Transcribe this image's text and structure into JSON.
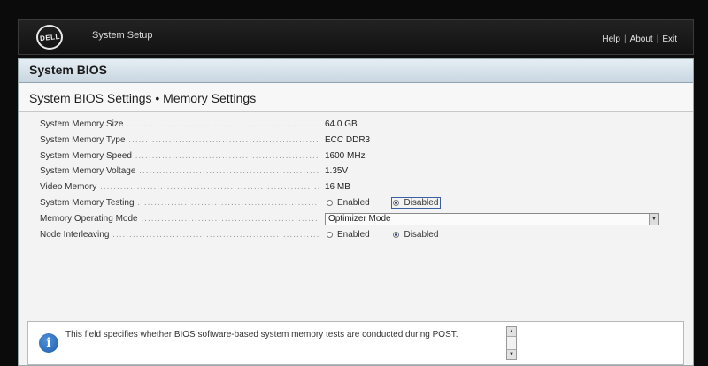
{
  "header": {
    "logo_text": "DELL",
    "app_title": "System Setup",
    "links": {
      "help": "Help",
      "about": "About",
      "exit": "Exit",
      "separator": "|"
    }
  },
  "panel": {
    "title": "System BIOS",
    "subtitle": "System BIOS Settings • Memory Settings"
  },
  "settings": {
    "memory_size": {
      "label": "System Memory Size",
      "value": "64.0 GB"
    },
    "memory_type": {
      "label": "System Memory Type",
      "value": "ECC DDR3"
    },
    "memory_speed": {
      "label": "System Memory Speed",
      "value": "1600 MHz"
    },
    "memory_voltage": {
      "label": "System Memory Voltage",
      "value": "1.35V"
    },
    "video_memory": {
      "label": "Video Memory",
      "value": "16 MB"
    },
    "memory_testing": {
      "label": "System Memory Testing",
      "options": [
        "Enabled",
        "Disabled"
      ],
      "selected": "Disabled"
    },
    "operating_mode": {
      "label": "Memory Operating Mode",
      "value": "Optimizer Mode"
    },
    "node_interleaving": {
      "label": "Node Interleaving",
      "options": [
        "Enabled",
        "Disabled"
      ],
      "selected": "Disabled"
    }
  },
  "help": {
    "icon": "info-icon",
    "text": "This field specifies whether BIOS software-based system memory tests are conducted during POST."
  },
  "colors": {
    "header_bg": "#181818",
    "panel_bg": "#f3f3f3",
    "panel_header": "#c9d6e0",
    "accent": "#1d5fb0"
  }
}
